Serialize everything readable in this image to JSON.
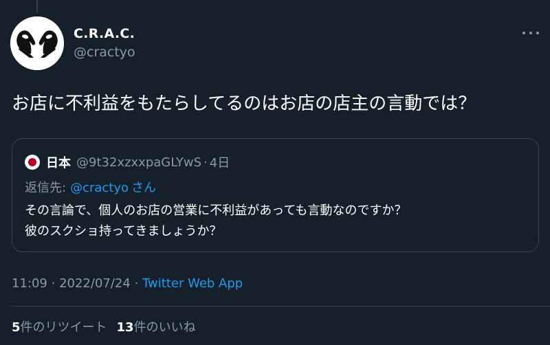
{
  "author": {
    "display_name": "C.R.A.C.",
    "handle": "@cractyo",
    "avatar_icon": "hands-logo-icon"
  },
  "tweet": {
    "text": "お店に不利益をもたらしてるのはお店の店主の言動では？"
  },
  "quote": {
    "flag_icon": "japan-flag-icon",
    "name": "日本",
    "handle": "@9t32xzxxpaGLYwS",
    "separator": "·",
    "time": "4日",
    "reply_prefix": "返信先:",
    "reply_mention": "@cractyo",
    "reply_suffix": "さん",
    "body_line1": "その言論で、個人のお店の営業に不利益があっても言動なのですか？",
    "body_line2": "彼のスクショ持ってきましょうか？"
  },
  "meta": {
    "time": "11:09",
    "separator1": "·",
    "date": "2022/07/24",
    "separator2": "·",
    "source": "Twitter Web App"
  },
  "stats": {
    "retweets_count": "5",
    "retweets_label": "件のリツイート",
    "likes_count": "13",
    "likes_label": "件のいいね"
  },
  "colors": {
    "background": "#15202b",
    "border": "#38444d",
    "secondary_text": "#8b98a5",
    "link": "#1d9bf0"
  }
}
